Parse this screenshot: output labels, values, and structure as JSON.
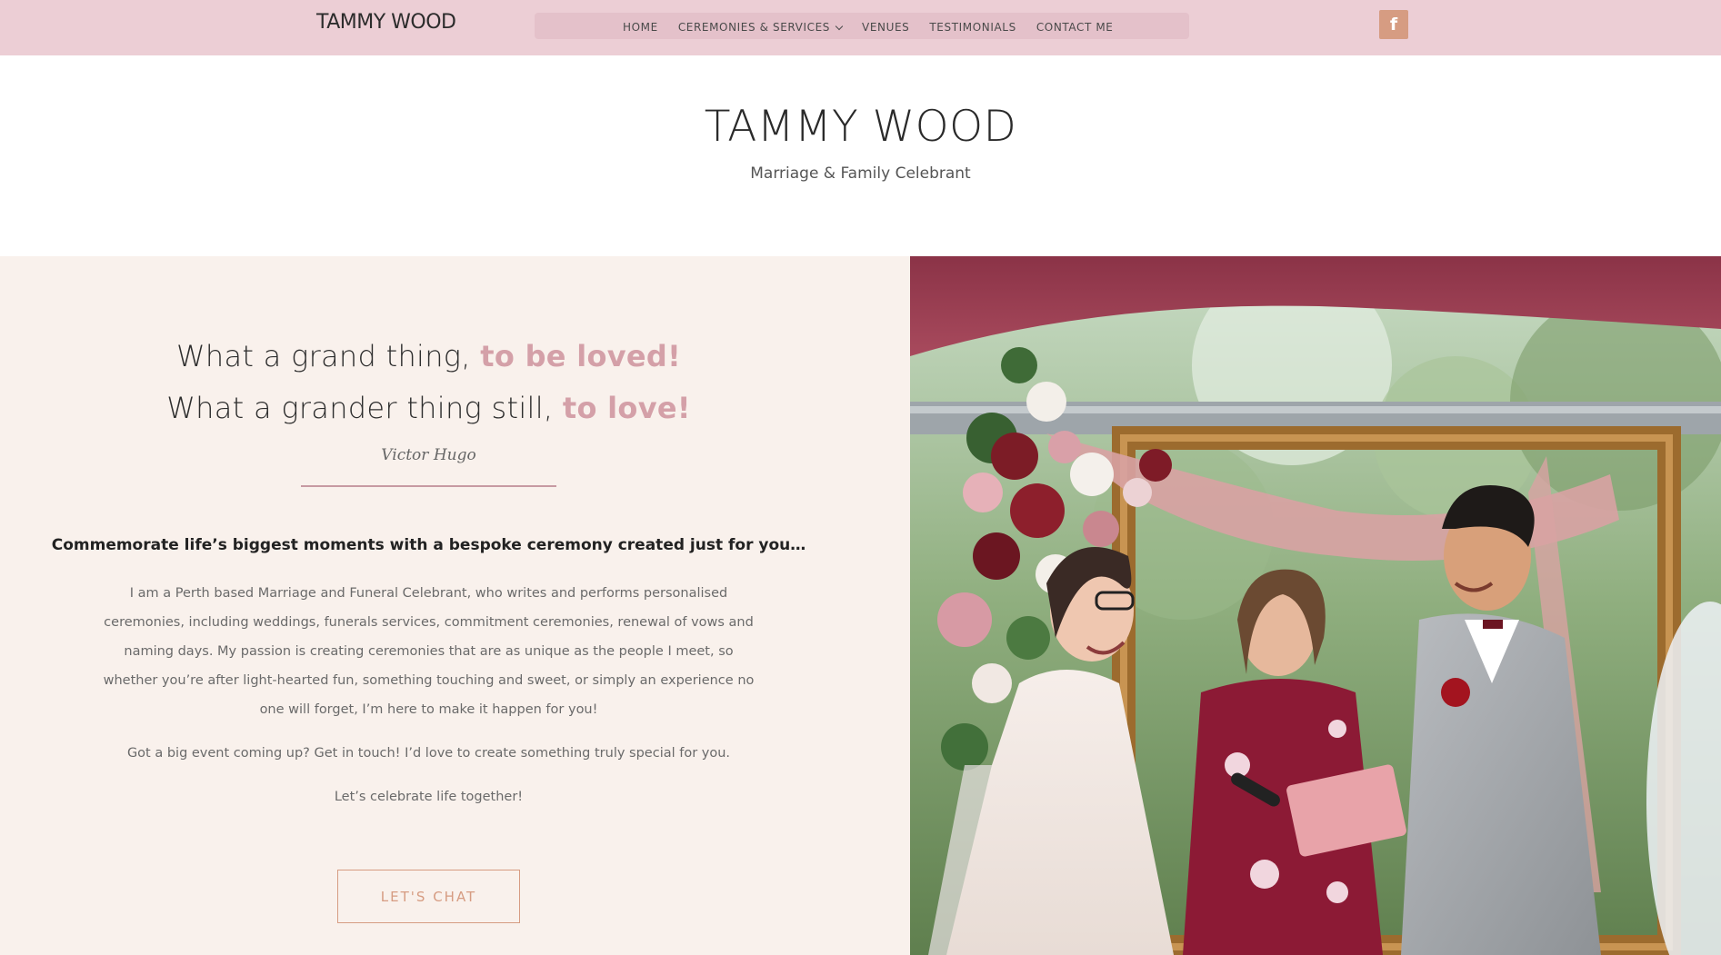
{
  "nav": {
    "brand": "TAMMY WOOD",
    "items": [
      {
        "label": "HOME"
      },
      {
        "label": "CEREMONIES & SERVICES"
      },
      {
        "label": "VENUES"
      },
      {
        "label": "TESTIMONIALS"
      },
      {
        "label": "CONTACT ME"
      }
    ],
    "social_icon": "facebook-icon",
    "social_glyph": "f"
  },
  "header": {
    "title": "TAMMY WOOD",
    "subtitle": "Marriage & Family Celebrant"
  },
  "intro": {
    "quote_line1_start": "What a grand thing, ",
    "quote_line1_accent": "to be loved!",
    "quote_line2_start": "What a grander thing still, ",
    "quote_line2_accent": "to love!",
    "author": "Victor Hugo",
    "tagline": "Commemorate life’s biggest moments with a bespoke ceremony created just for you…",
    "paragraphs": [
      "I am a Perth based Marriage and Funeral Celebrant, who writes and performs personalised ceremonies, including weddings, funerals services, commitment ceremonies, renewal of vows and naming days. My passion is creating ceremonies that are as unique as the people I meet, so whether you’re after light-hearted fun, something touching and sweet, or simply an experience no one will forget, I’m here to make it happen for you!",
      "Got a big event coming up? Get in touch! I’d love to create something truly special for you.",
      "Let’s celebrate life together!"
    ],
    "cta_label": "LET'S CHAT"
  },
  "colors": {
    "nav_bg": "#ecced5",
    "panel_bg": "#f9f1ec",
    "accent_pink": "#d4a0a8",
    "accent_copper": "#d69c82"
  }
}
